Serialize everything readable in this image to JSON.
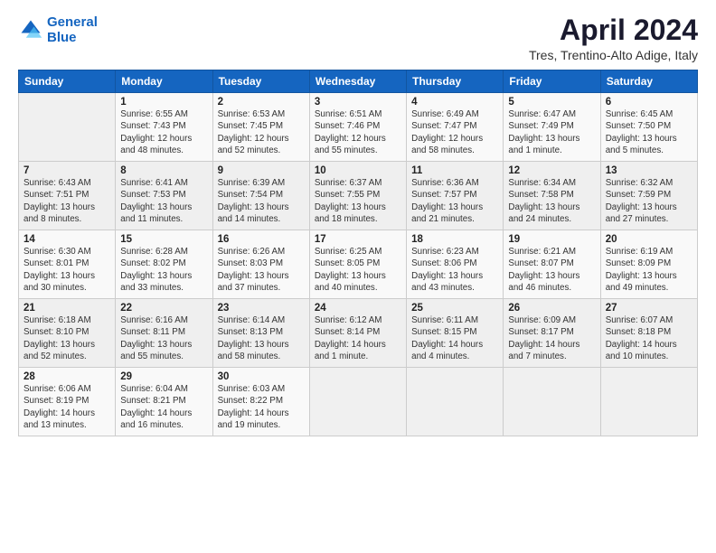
{
  "header": {
    "logo_line1": "General",
    "logo_line2": "Blue",
    "title": "April 2024",
    "subtitle": "Tres, Trentino-Alto Adige, Italy"
  },
  "weekdays": [
    "Sunday",
    "Monday",
    "Tuesday",
    "Wednesday",
    "Thursday",
    "Friday",
    "Saturday"
  ],
  "weeks": [
    [
      {
        "day": "",
        "info": ""
      },
      {
        "day": "1",
        "info": "Sunrise: 6:55 AM\nSunset: 7:43 PM\nDaylight: 12 hours\nand 48 minutes."
      },
      {
        "day": "2",
        "info": "Sunrise: 6:53 AM\nSunset: 7:45 PM\nDaylight: 12 hours\nand 52 minutes."
      },
      {
        "day": "3",
        "info": "Sunrise: 6:51 AM\nSunset: 7:46 PM\nDaylight: 12 hours\nand 55 minutes."
      },
      {
        "day": "4",
        "info": "Sunrise: 6:49 AM\nSunset: 7:47 PM\nDaylight: 12 hours\nand 58 minutes."
      },
      {
        "day": "5",
        "info": "Sunrise: 6:47 AM\nSunset: 7:49 PM\nDaylight: 13 hours\nand 1 minute."
      },
      {
        "day": "6",
        "info": "Sunrise: 6:45 AM\nSunset: 7:50 PM\nDaylight: 13 hours\nand 5 minutes."
      }
    ],
    [
      {
        "day": "7",
        "info": "Sunrise: 6:43 AM\nSunset: 7:51 PM\nDaylight: 13 hours\nand 8 minutes."
      },
      {
        "day": "8",
        "info": "Sunrise: 6:41 AM\nSunset: 7:53 PM\nDaylight: 13 hours\nand 11 minutes."
      },
      {
        "day": "9",
        "info": "Sunrise: 6:39 AM\nSunset: 7:54 PM\nDaylight: 13 hours\nand 14 minutes."
      },
      {
        "day": "10",
        "info": "Sunrise: 6:37 AM\nSunset: 7:55 PM\nDaylight: 13 hours\nand 18 minutes."
      },
      {
        "day": "11",
        "info": "Sunrise: 6:36 AM\nSunset: 7:57 PM\nDaylight: 13 hours\nand 21 minutes."
      },
      {
        "day": "12",
        "info": "Sunrise: 6:34 AM\nSunset: 7:58 PM\nDaylight: 13 hours\nand 24 minutes."
      },
      {
        "day": "13",
        "info": "Sunrise: 6:32 AM\nSunset: 7:59 PM\nDaylight: 13 hours\nand 27 minutes."
      }
    ],
    [
      {
        "day": "14",
        "info": "Sunrise: 6:30 AM\nSunset: 8:01 PM\nDaylight: 13 hours\nand 30 minutes."
      },
      {
        "day": "15",
        "info": "Sunrise: 6:28 AM\nSunset: 8:02 PM\nDaylight: 13 hours\nand 33 minutes."
      },
      {
        "day": "16",
        "info": "Sunrise: 6:26 AM\nSunset: 8:03 PM\nDaylight: 13 hours\nand 37 minutes."
      },
      {
        "day": "17",
        "info": "Sunrise: 6:25 AM\nSunset: 8:05 PM\nDaylight: 13 hours\nand 40 minutes."
      },
      {
        "day": "18",
        "info": "Sunrise: 6:23 AM\nSunset: 8:06 PM\nDaylight: 13 hours\nand 43 minutes."
      },
      {
        "day": "19",
        "info": "Sunrise: 6:21 AM\nSunset: 8:07 PM\nDaylight: 13 hours\nand 46 minutes."
      },
      {
        "day": "20",
        "info": "Sunrise: 6:19 AM\nSunset: 8:09 PM\nDaylight: 13 hours\nand 49 minutes."
      }
    ],
    [
      {
        "day": "21",
        "info": "Sunrise: 6:18 AM\nSunset: 8:10 PM\nDaylight: 13 hours\nand 52 minutes."
      },
      {
        "day": "22",
        "info": "Sunrise: 6:16 AM\nSunset: 8:11 PM\nDaylight: 13 hours\nand 55 minutes."
      },
      {
        "day": "23",
        "info": "Sunrise: 6:14 AM\nSunset: 8:13 PM\nDaylight: 13 hours\nand 58 minutes."
      },
      {
        "day": "24",
        "info": "Sunrise: 6:12 AM\nSunset: 8:14 PM\nDaylight: 14 hours\nand 1 minute."
      },
      {
        "day": "25",
        "info": "Sunrise: 6:11 AM\nSunset: 8:15 PM\nDaylight: 14 hours\nand 4 minutes."
      },
      {
        "day": "26",
        "info": "Sunrise: 6:09 AM\nSunset: 8:17 PM\nDaylight: 14 hours\nand 7 minutes."
      },
      {
        "day": "27",
        "info": "Sunrise: 6:07 AM\nSunset: 8:18 PM\nDaylight: 14 hours\nand 10 minutes."
      }
    ],
    [
      {
        "day": "28",
        "info": "Sunrise: 6:06 AM\nSunset: 8:19 PM\nDaylight: 14 hours\nand 13 minutes."
      },
      {
        "day": "29",
        "info": "Sunrise: 6:04 AM\nSunset: 8:21 PM\nDaylight: 14 hours\nand 16 minutes."
      },
      {
        "day": "30",
        "info": "Sunrise: 6:03 AM\nSunset: 8:22 PM\nDaylight: 14 hours\nand 19 minutes."
      },
      {
        "day": "",
        "info": ""
      },
      {
        "day": "",
        "info": ""
      },
      {
        "day": "",
        "info": ""
      },
      {
        "day": "",
        "info": ""
      }
    ]
  ]
}
